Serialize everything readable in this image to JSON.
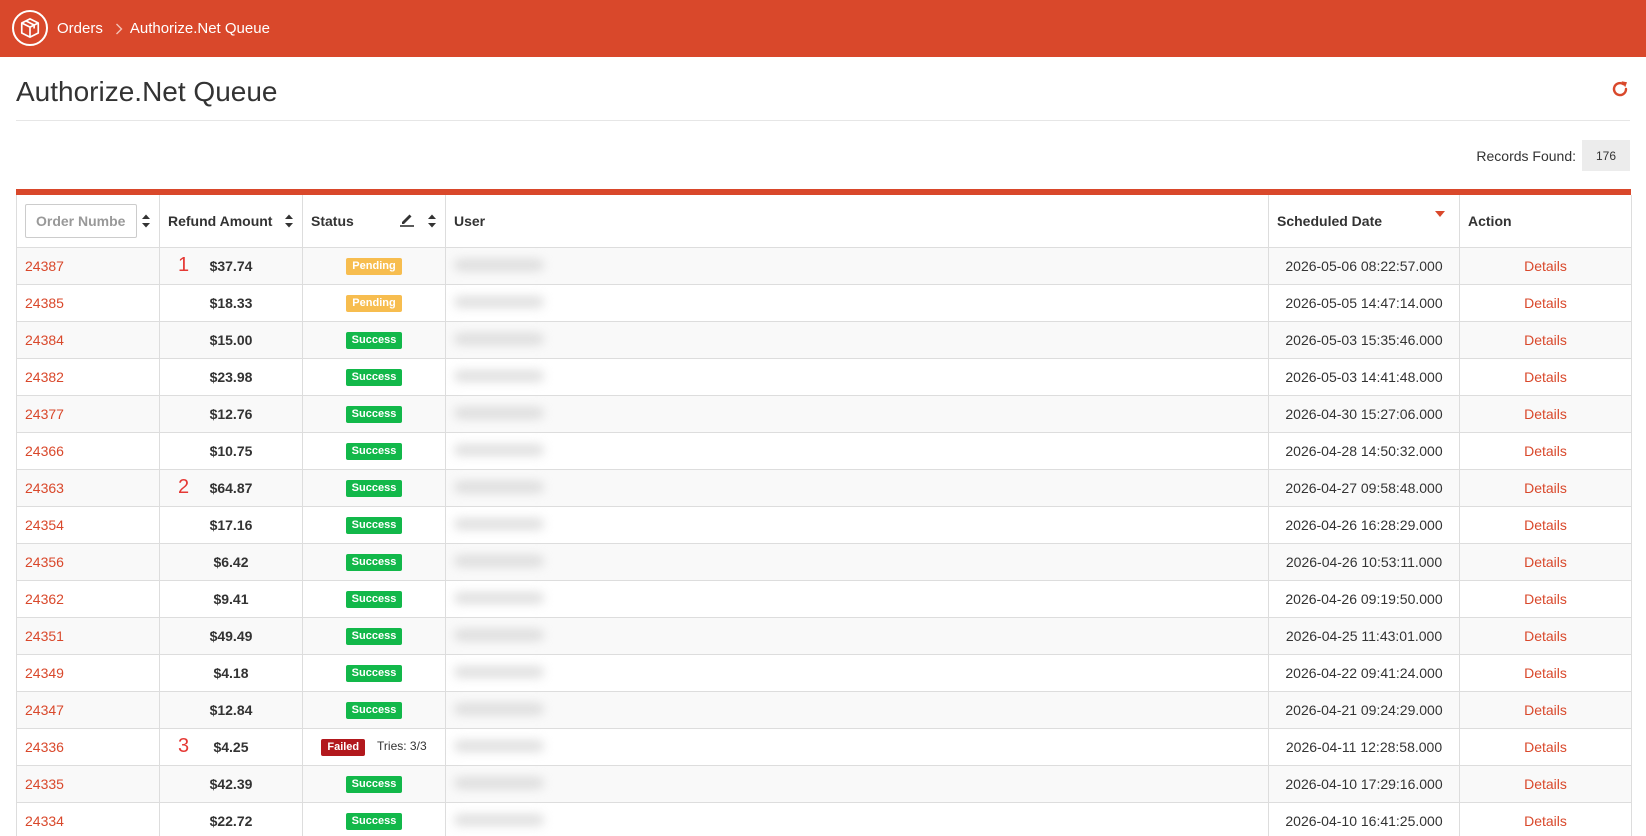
{
  "breadcrumb": {
    "orders_label": "Orders",
    "current_label": "Authorize.Net Queue"
  },
  "page": {
    "title": "Authorize.Net Queue",
    "records_label": "Records Found:",
    "records_count": "176"
  },
  "table": {
    "columns": {
      "order_placeholder": "Order Number",
      "refund_amount": "Refund Amount",
      "status": "Status",
      "user": "User",
      "scheduled_date": "Scheduled Date",
      "action": "Action"
    },
    "rows": [
      {
        "order": "24387",
        "amount": "$37.74",
        "status": "Pending",
        "date": "2026-05-06 08:22:57.000",
        "action": "Details",
        "annotation": "1"
      },
      {
        "order": "24385",
        "amount": "$18.33",
        "status": "Pending",
        "date": "2026-05-05 14:47:14.000",
        "action": "Details"
      },
      {
        "order": "24384",
        "amount": "$15.00",
        "status": "Success",
        "date": "2026-05-03 15:35:46.000",
        "action": "Details"
      },
      {
        "order": "24382",
        "amount": "$23.98",
        "status": "Success",
        "date": "2026-05-03 14:41:48.000",
        "action": "Details"
      },
      {
        "order": "24377",
        "amount": "$12.76",
        "status": "Success",
        "date": "2026-04-30 15:27:06.000",
        "action": "Details"
      },
      {
        "order": "24366",
        "amount": "$10.75",
        "status": "Success",
        "date": "2026-04-28 14:50:32.000",
        "action": "Details"
      },
      {
        "order": "24363",
        "amount": "$64.87",
        "status": "Success",
        "date": "2026-04-27 09:58:48.000",
        "action": "Details",
        "annotation": "2"
      },
      {
        "order": "24354",
        "amount": "$17.16",
        "status": "Success",
        "date": "2026-04-26 16:28:29.000",
        "action": "Details"
      },
      {
        "order": "24356",
        "amount": "$6.42",
        "status": "Success",
        "date": "2026-04-26 10:53:11.000",
        "action": "Details"
      },
      {
        "order": "24362",
        "amount": "$9.41",
        "status": "Success",
        "date": "2026-04-26 09:19:50.000",
        "action": "Details"
      },
      {
        "order": "24351",
        "amount": "$49.49",
        "status": "Success",
        "date": "2026-04-25 11:43:01.000",
        "action": "Details"
      },
      {
        "order": "24349",
        "amount": "$4.18",
        "status": "Success",
        "date": "2026-04-22 09:41:24.000",
        "action": "Details"
      },
      {
        "order": "24347",
        "amount": "$12.84",
        "status": "Success",
        "date": "2026-04-21 09:24:29.000",
        "action": "Details"
      },
      {
        "order": "24336",
        "amount": "$4.25",
        "status": "Failed",
        "tries": "Tries: 3/3",
        "date": "2026-04-11 12:28:58.000",
        "action": "Details",
        "annotation": "3"
      },
      {
        "order": "24335",
        "amount": "$42.39",
        "status": "Success",
        "date": "2026-04-10 17:29:16.000",
        "action": "Details"
      },
      {
        "order": "24334",
        "amount": "$22.72",
        "status": "Success",
        "date": "2026-04-10 16:41:25.000",
        "action": "Details"
      }
    ]
  },
  "colors": {
    "brand": "#d9482b",
    "pending": "#f7bd4f",
    "success": "#12b84a",
    "failed": "#b2181d"
  },
  "icons": {
    "logo": "package-box-icon",
    "breadcrumb_separator": "chevron-right-icon",
    "refresh": "refresh-icon",
    "sort": "sort-updown-icon",
    "edit": "pencil-icon",
    "sort_active": "sort-desc-icon"
  }
}
